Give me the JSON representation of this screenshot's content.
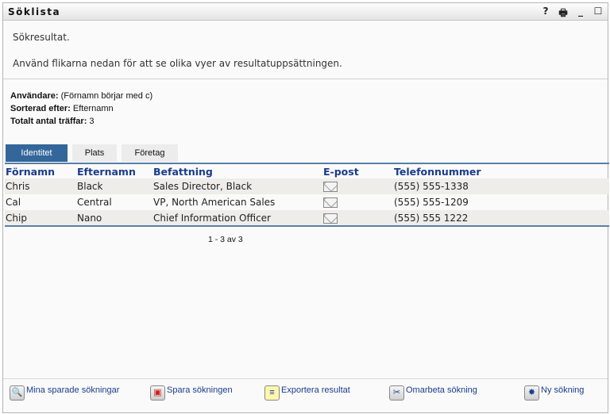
{
  "window": {
    "title": "Söklista",
    "help": "?",
    "print": "🖶",
    "minimize": "_",
    "maximize": "☐"
  },
  "intro": {
    "line1": "Sökresultat.",
    "line2": "Använd flikarna nedan för att se olika vyer av resultatuppsättningen."
  },
  "info": {
    "user_label": "Användare:",
    "user_value": "(Förnamn börjar med c)",
    "sort_label": "Sorterad efter:",
    "sort_value": "Efternamn",
    "total_label": "Totalt antal träffar:",
    "total_value": "3"
  },
  "tabs": [
    "Identitet",
    "Plats",
    "Företag"
  ],
  "table": {
    "headers": [
      "Förnamn",
      "Efternamn",
      "Befattning",
      "E-post",
      "Telefonnummer"
    ],
    "rows": [
      {
        "first": "Chris",
        "last": "Black",
        "title": "Sales Director, Black",
        "phone": "(555) 555-1338"
      },
      {
        "first": "Cal",
        "last": "Central",
        "title": "VP, North American Sales",
        "phone": "(555) 555-1209"
      },
      {
        "first": "Chip",
        "last": "Nano",
        "title": "Chief Information Officer",
        "phone": "(555) 555 1222"
      }
    ]
  },
  "pager": "1 - 3 av 3",
  "footer": [
    "Mina sparade sökningar",
    "Spara sökningen",
    "Exportera resultat",
    "Omarbeta sökning",
    "Ny sökning"
  ]
}
